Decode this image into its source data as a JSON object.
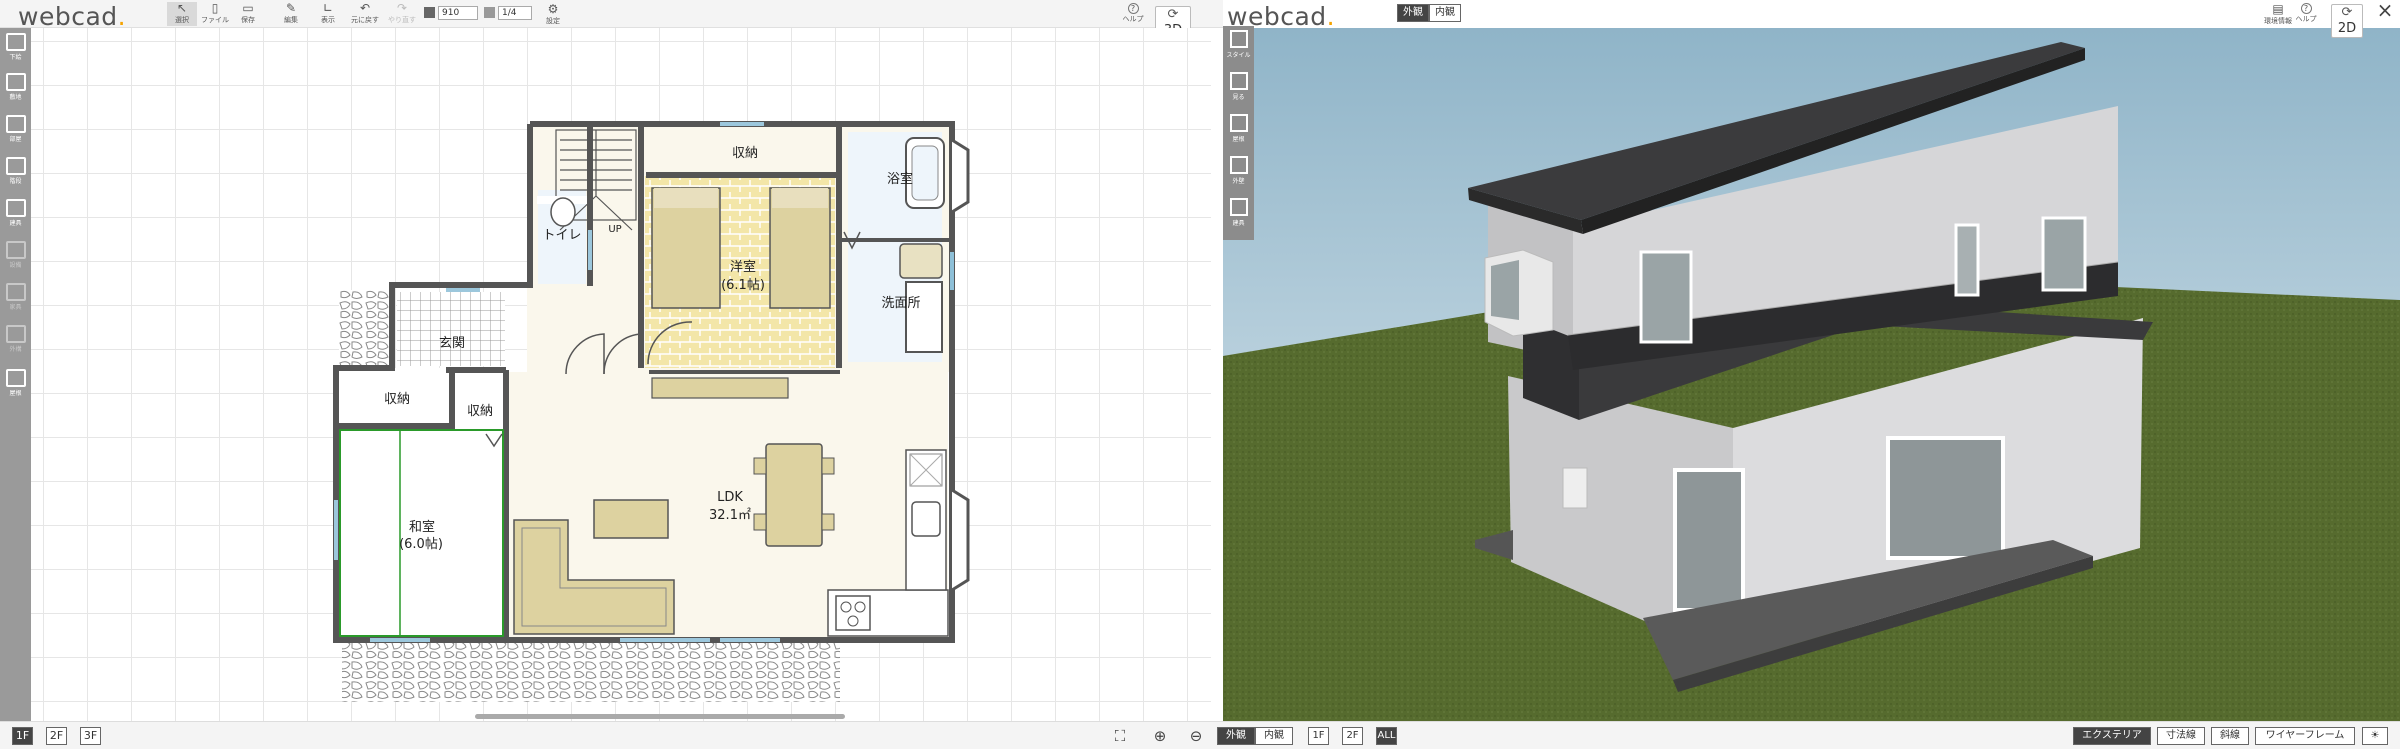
{
  "app": {
    "brand": "webcad",
    "brand_right": "webcad"
  },
  "toolbar": {
    "items": [
      {
        "label": "選択",
        "icon": "cursor-icon"
      },
      {
        "label": "ファイル",
        "icon": "file-icon"
      },
      {
        "label": "保存",
        "icon": "save-icon"
      },
      {
        "label": "編集",
        "icon": "edit-icon"
      },
      {
        "label": "表示",
        "icon": "ruler-icon"
      },
      {
        "label": "元に戻す",
        "icon": "undo-icon"
      },
      {
        "label": "やり直す",
        "icon": "redo-icon"
      }
    ],
    "grid_value": "910",
    "scale_value": "1/4",
    "settings_label": "設定",
    "help_label": "ヘルプ",
    "view3d_label": "3D"
  },
  "sidebar": {
    "items": [
      {
        "label": "下絵"
      },
      {
        "label": "敷地"
      },
      {
        "label": "部屋"
      },
      {
        "label": "階段"
      },
      {
        "label": "建具"
      },
      {
        "label": "設備"
      },
      {
        "label": "家具"
      },
      {
        "label": "外構"
      },
      {
        "label": "屋根"
      }
    ]
  },
  "floorplan": {
    "rooms": {
      "storage_top": "収納",
      "bath": "浴室",
      "toilet": "トイレ",
      "up": "UP",
      "western": "洋室",
      "western_size": "(6.1帖)",
      "washroom": "洗面所",
      "entrance": "玄関",
      "storage_left": "収納",
      "storage_mid": "収納",
      "washitsu": "和室",
      "washitsu_size": "(6.0帖)",
      "ldk": "LDK",
      "ldk_size": "32.1㎡"
    }
  },
  "footer": {
    "floors": [
      "1F",
      "2F",
      "3F"
    ],
    "selected_floor": "1F",
    "zoom_in": "⊕",
    "zoom_out": "⊖",
    "fit": "⛶"
  },
  "view3d": {
    "tabs": [
      "外観",
      "内観"
    ],
    "active_tab": "外観",
    "floors": [
      "1F",
      "2F",
      "ALL"
    ],
    "modes": [
      "エクステリア",
      "寸法線",
      "斜線",
      "ワイヤーフレーム",
      "☀"
    ],
    "active_mode": "エクステリア",
    "env_label": "環境情報",
    "help_label": "ヘルプ",
    "view2d_label": "2D",
    "close": "×",
    "sidebar": [
      {
        "label": "スタイル"
      },
      {
        "label": "見る"
      },
      {
        "label": "屋根"
      },
      {
        "label": "外壁"
      },
      {
        "label": "建具"
      }
    ]
  },
  "colors": {
    "accent": "#f5a300",
    "sidebar": "#9a9a9a",
    "wall": "#555555",
    "tatami_border": "#2a9a2a",
    "floor": "#faf7ec",
    "sky": "#9fc0d2",
    "grass": "#556b2f"
  }
}
